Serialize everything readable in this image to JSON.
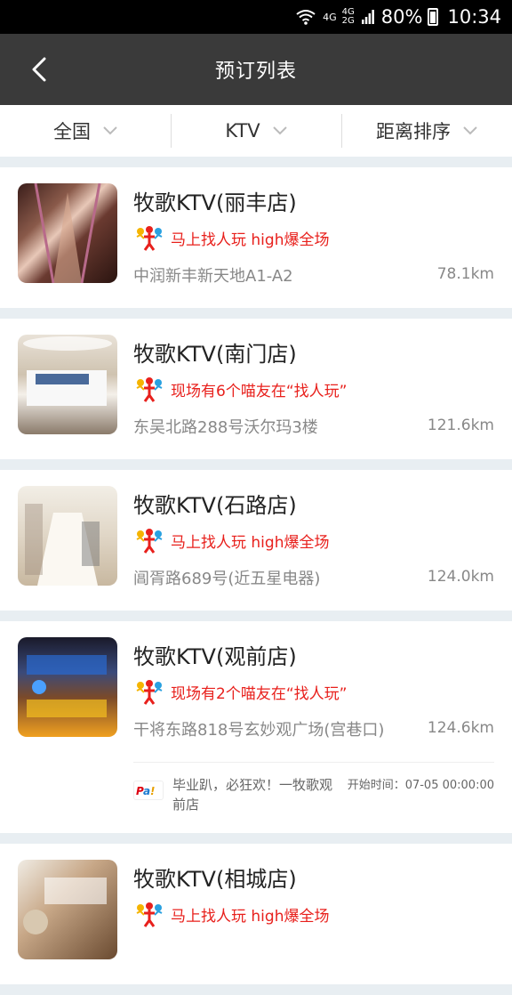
{
  "status_bar": {
    "net_top": "4G",
    "net_mid": "4G",
    "net_bottom": "2G",
    "battery": "80%",
    "time": "10:34"
  },
  "header": {
    "title": "预订列表"
  },
  "filters": [
    {
      "label": "全国"
    },
    {
      "label": "KTV"
    },
    {
      "label": "距离排序"
    }
  ],
  "stores": [
    {
      "name": "牧歌KTV(丽丰店)",
      "promo": "马上找人玩  high爆全场",
      "address": "中润新丰新天地A1-A2",
      "distance": "78.1km"
    },
    {
      "name": "牧歌KTV(南门店)",
      "promo": "现场有6个喵友在“找人玩”",
      "address": "东吴北路288号沃尔玛3楼",
      "distance": "121.6km"
    },
    {
      "name": "牧歌KTV(石路店)",
      "promo": "马上找人玩  high爆全场",
      "address": "阊胥路689号(近五星电器)",
      "distance": "124.0km"
    },
    {
      "name": "牧歌KTV(观前店)",
      "promo": "现场有2个喵友在“找人玩”",
      "address": "干将东路818号玄妙观广场(宫巷口)",
      "distance": "124.6km",
      "event": {
        "text": "毕业趴，必狂欢！一牧歌观前店",
        "time": "开始时间：07-05 00:00:00"
      }
    },
    {
      "name": "牧歌KTV(相城店)",
      "promo": "马上找人玩  high爆全场",
      "address": "",
      "distance": ""
    }
  ],
  "colors": {
    "header_bg": "#3a3a3a",
    "promo_red": "#e8201c",
    "page_bg": "#e8eef2"
  }
}
